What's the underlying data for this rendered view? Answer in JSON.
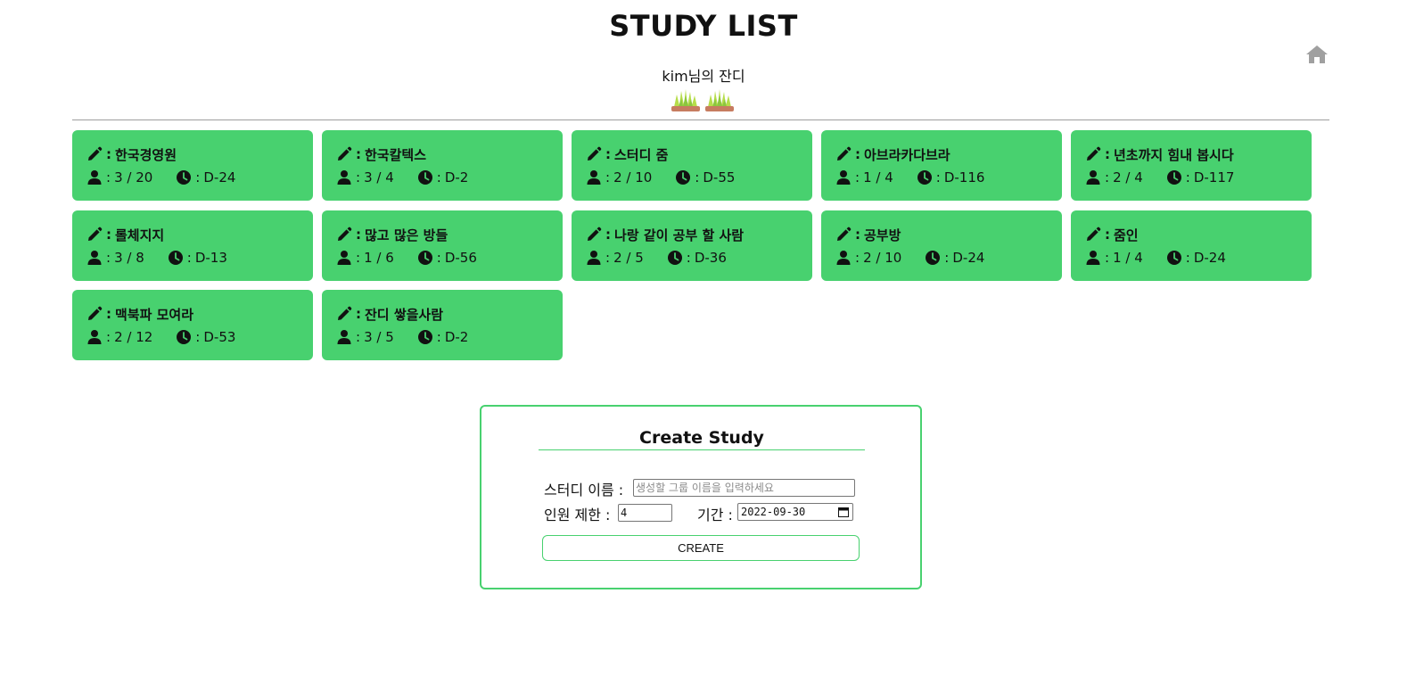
{
  "header": {
    "title": "STUDY LIST",
    "subtitle": "kim님의 잔디",
    "home_icon": "home-icon",
    "grass_count": 2
  },
  "colors": {
    "card_bg": "#48d16f",
    "accent": "#48d16f",
    "grass_green": "#b6dd4a",
    "grass_pot": "#c77c60",
    "home_gray": "#a0a0a0"
  },
  "icons": {
    "name": "pencil-icon",
    "members": "user-icon",
    "deadline": "clock-icon"
  },
  "card_labels": {
    "sep": ":"
  },
  "studies": [
    {
      "name": "한국경영원",
      "members": "3 / 20",
      "dday": "D-24"
    },
    {
      "name": "한국칼텍스",
      "members": "3 / 4",
      "dday": "D-2"
    },
    {
      "name": "스터디 줌",
      "members": "2 / 10",
      "dday": "D-55"
    },
    {
      "name": "아브라카다브라",
      "members": "1 / 4",
      "dday": "D-116"
    },
    {
      "name": "년초까지 힘내 봅시다",
      "members": "2 / 4",
      "dday": "D-117"
    },
    {
      "name": "롤체지지",
      "members": "3 / 8",
      "dday": "D-13"
    },
    {
      "name": "많고 많은 방들",
      "members": "1 / 6",
      "dday": "D-56"
    },
    {
      "name": "나랑 같이 공부 할 사람",
      "members": "2 / 5",
      "dday": "D-36"
    },
    {
      "name": "공부방",
      "members": "2 / 10",
      "dday": "D-24"
    },
    {
      "name": "줌인",
      "members": "1 / 4",
      "dday": "D-24"
    },
    {
      "name": "맥북파 모여라",
      "members": "2 / 12",
      "dday": "D-53"
    },
    {
      "name": "잔디 쌓을사람",
      "members": "3 / 5",
      "dday": "D-2"
    }
  ],
  "form": {
    "title": "Create Study",
    "name_label": "스터디 이름 :",
    "name_value": "",
    "name_placeholder": "생성할 그룹 이름을 입력하세요",
    "limit_label": "인원 제한 :",
    "limit_value": "4",
    "period_label": "기간 :",
    "period_value": "2022-09-30",
    "submit_label": "CREATE"
  }
}
